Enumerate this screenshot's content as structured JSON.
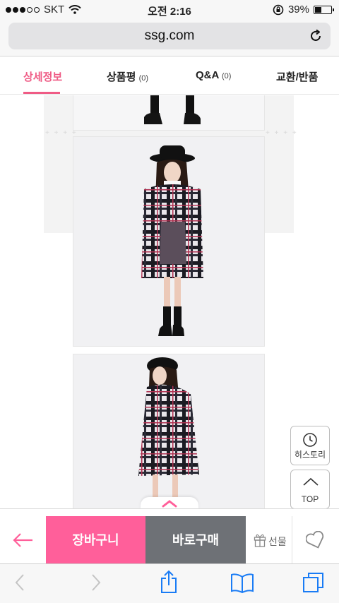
{
  "status_bar": {
    "carrier": "SKT",
    "time": "오전 2:16",
    "battery_percent": "39%",
    "battery_level": 0.39
  },
  "browser": {
    "url": "ssg.com"
  },
  "tabs": [
    {
      "label": "상세정보",
      "count": ""
    },
    {
      "label": "상품평",
      "count": "(0)"
    },
    {
      "label": "Q&A",
      "count": "(0)"
    },
    {
      "label": "교환/반품",
      "count": ""
    }
  ],
  "floating": {
    "history_label": "히스토리",
    "top_label": "TOP"
  },
  "actions": {
    "cart_label": "장바구니",
    "buy_label": "바로구매",
    "gift_label": "선물"
  },
  "colors": {
    "accent": "#ef5b85",
    "cart": "#ff5f9a",
    "buy": "#6e7176",
    "ios_blue": "#1a7cf5"
  }
}
